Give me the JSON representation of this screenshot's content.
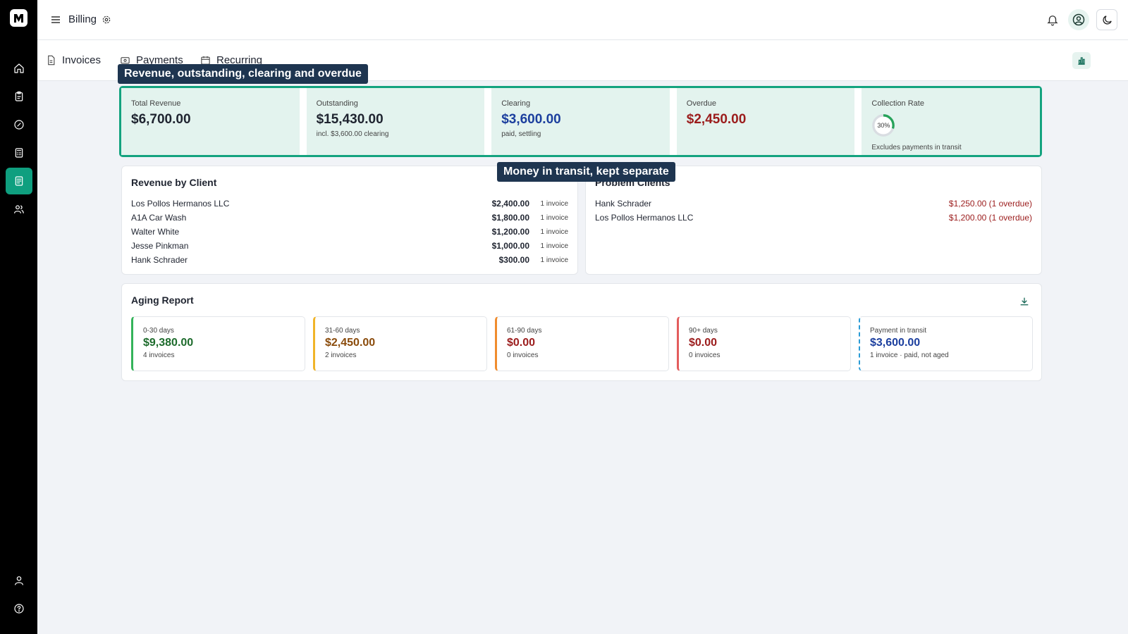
{
  "header": {
    "title": "Billing"
  },
  "tabs": [
    {
      "label": "Invoices"
    },
    {
      "label": "Payments"
    },
    {
      "label": "Recurring"
    }
  ],
  "tooltips": {
    "stats": "Revenue, outstanding, clearing and overdue",
    "transit": "Money in transit, kept separate"
  },
  "stats": {
    "total_revenue": {
      "label": "Total Revenue",
      "value": "$6,700.00"
    },
    "outstanding": {
      "label": "Outstanding",
      "value": "$15,430.00",
      "sub": "incl. $3,600.00 clearing"
    },
    "clearing": {
      "label": "Clearing",
      "value": "$3,600.00",
      "sub": "paid, settling"
    },
    "overdue": {
      "label": "Overdue",
      "value": "$2,450.00"
    },
    "collection_rate": {
      "label": "Collection Rate",
      "value": "30%",
      "percent": 30,
      "sub": "Excludes payments in transit"
    }
  },
  "revenue_by_client": {
    "title": "Revenue by Client",
    "rows": [
      {
        "name": "Los Pollos Hermanos LLC",
        "amount": "$2,400.00",
        "count": "1 invoice"
      },
      {
        "name": "A1A Car Wash",
        "amount": "$1,800.00",
        "count": "1 invoice"
      },
      {
        "name": "Walter White",
        "amount": "$1,200.00",
        "count": "1 invoice"
      },
      {
        "name": "Jesse Pinkman",
        "amount": "$1,000.00",
        "count": "1 invoice"
      },
      {
        "name": "Hank Schrader",
        "amount": "$300.00",
        "count": "1 invoice"
      }
    ]
  },
  "problem_clients": {
    "title": "Problem Clients",
    "rows": [
      {
        "name": "Hank Schrader",
        "amount": "$1,250.00 (1 overdue)"
      },
      {
        "name": "Los Pollos Hermanos LLC",
        "amount": "$1,200.00 (1 overdue)"
      }
    ]
  },
  "aging": {
    "title": "Aging Report",
    "buckets": [
      {
        "label": "0-30 days",
        "value": "$9,380.00",
        "sub": "4 invoices"
      },
      {
        "label": "31-60 days",
        "value": "$2,450.00",
        "sub": "2 invoices"
      },
      {
        "label": "61-90 days",
        "value": "$0.00",
        "sub": "0 invoices"
      },
      {
        "label": "90+ days",
        "value": "$0.00",
        "sub": "0 invoices"
      },
      {
        "label": "Payment in transit",
        "value": "$3,600.00",
        "sub": "1 invoice · paid, not aged"
      }
    ]
  },
  "colors": {
    "accent": "#14a37f",
    "tooltip_bg": "#1e3550",
    "blue": "#1c3f9e",
    "red": "#9b1c1c",
    "green": "#1d6b2c",
    "amber": "#8a4b0b",
    "aging_borders": [
      "#34b35a",
      "#f0b429",
      "#f08c2e",
      "#e35d5d",
      "#2a9bd6"
    ]
  },
  "icons": {
    "sidebar": [
      "home-icon",
      "clipboard-icon",
      "gauge-icon",
      "calculator-icon",
      "document-icon",
      "users-icon",
      "user-icon",
      "help-icon"
    ]
  }
}
